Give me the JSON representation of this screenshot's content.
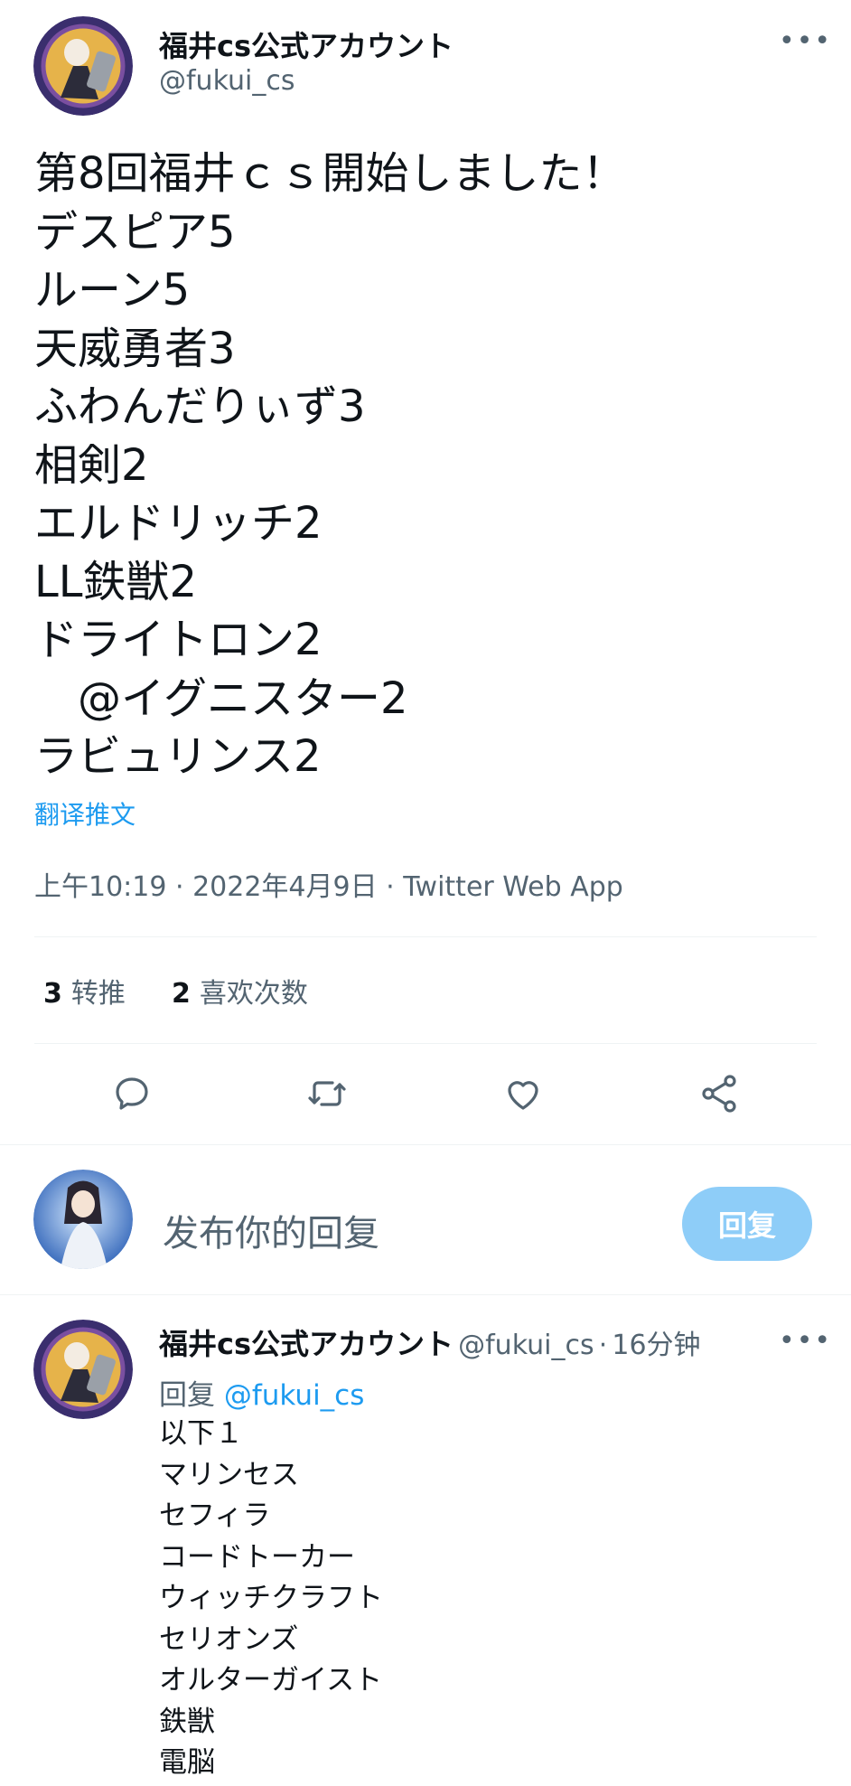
{
  "tweet": {
    "author_name": "福井cs公式アカウント",
    "author_handle": "@fukui_cs",
    "more_icon": "more-dots-icon",
    "lines": [
      "第8回福井ｃｓ開始しました！",
      "デスピア5",
      "ルーン5",
      "天威勇者3",
      "ふわんだりぃず3",
      "相剣2",
      "エルドリッチ2",
      "LL鉄獣2",
      "ドライトロン2",
      "　@イグニスター2",
      "ラビュリンス2"
    ],
    "translate_label": "翻译推文",
    "meta": "上午10:19 · 2022年4月9日 · Twitter Web App",
    "retweets_count": "3",
    "retweets_label": "转推",
    "likes_count": "2",
    "likes_label": "喜欢次数"
  },
  "actions": [
    "reply-icon",
    "retweet-icon",
    "like-icon",
    "share-icon"
  ],
  "composer": {
    "placeholder": "发布你的回复",
    "button_label": "回复"
  },
  "reply": {
    "author_name": "福井cs公式アカウント",
    "author_handle": "@fukui_cs",
    "time": "16分钟",
    "replying_to_label": "回复",
    "replying_to_handle": "@fukui_cs",
    "lines": [
      "以下１",
      "マリンセス",
      "セフィラ",
      "コードトーカー",
      "ウィッチクラフト",
      "セリオンズ",
      "オルターガイスト",
      "鉄獣",
      "電脳"
    ]
  }
}
